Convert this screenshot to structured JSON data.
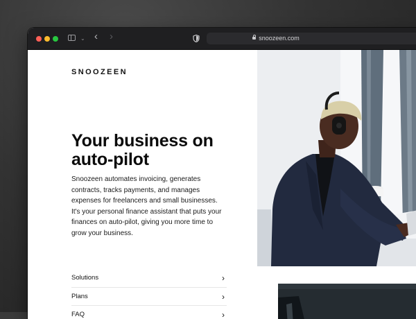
{
  "browser": {
    "url": "snoozeen.com"
  },
  "site": {
    "logo": "SNOOZEEN",
    "headline": "Your business on auto-pilot",
    "description": "Snoozeen automates invoicing, generates contracts, tracks payments, and manages expenses for freelancers and small businesses. It's your personal finance assistant that puts your finances on auto-pilot, giving you more time to grow your business.",
    "nav": [
      {
        "label": "Solutions"
      },
      {
        "label": "Plans"
      },
      {
        "label": "FAQ"
      }
    ]
  },
  "icons": {
    "window_controls": [
      "close-icon",
      "minimize-icon",
      "zoom-icon"
    ],
    "toolbar": [
      "sidebar-toggle-icon",
      "chevron-down-icon",
      "back-arrow-icon",
      "forward-arrow-icon",
      "privacy-shield-icon",
      "lock-icon"
    ],
    "nav": "chevron-right-icon"
  },
  "colors": {
    "toolbar_bg": "#1f1f21",
    "close": "#ff5f57",
    "minimize": "#febc2e",
    "zoom": "#28c840",
    "text": "#0b0b0b"
  }
}
